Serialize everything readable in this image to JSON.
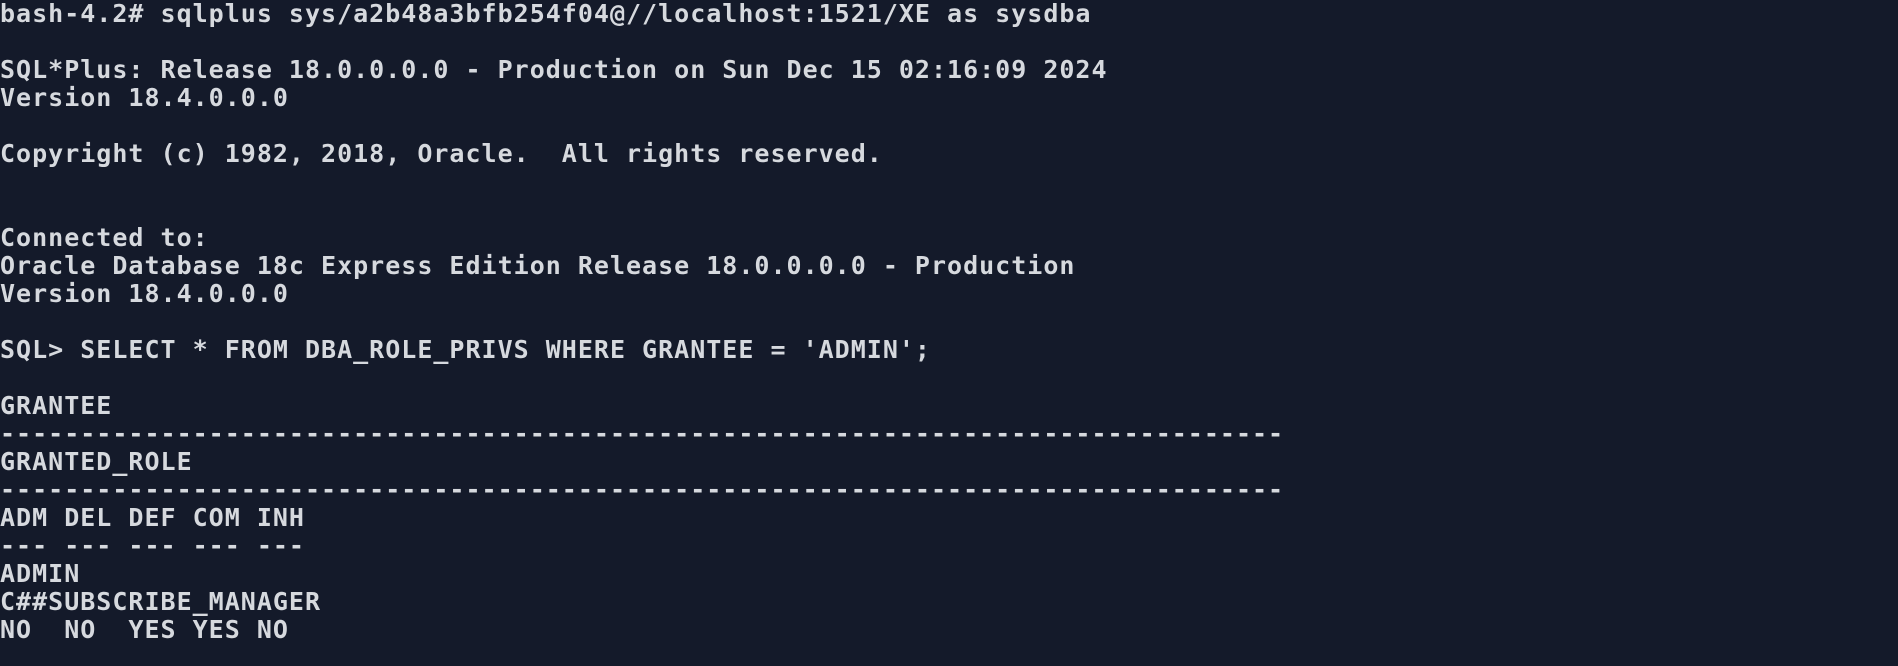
{
  "terminal": {
    "lines": [
      "bash-4.2# sqlplus sys/a2b48a3bfb254f04@//localhost:1521/XE as sysdba",
      "",
      "SQL*Plus: Release 18.0.0.0.0 - Production on Sun Dec 15 02:16:09 2024",
      "Version 18.4.0.0.0",
      "",
      "Copyright (c) 1982, 2018, Oracle.  All rights reserved.",
      "",
      "",
      "Connected to:",
      "Oracle Database 18c Express Edition Release 18.0.0.0.0 - Production",
      "Version 18.4.0.0.0",
      "",
      "SQL> SELECT * FROM DBA_ROLE_PRIVS WHERE GRANTEE = 'ADMIN';",
      "",
      "GRANTEE",
      "--------------------------------------------------------------------------------",
      "GRANTED_ROLE",
      "--------------------------------------------------------------------------------",
      "ADM DEL DEF COM INH",
      "--- --- --- --- ---",
      "ADMIN",
      "C##SUBSCRIBE_MANAGER",
      "NO  NO  YES YES NO"
    ]
  }
}
